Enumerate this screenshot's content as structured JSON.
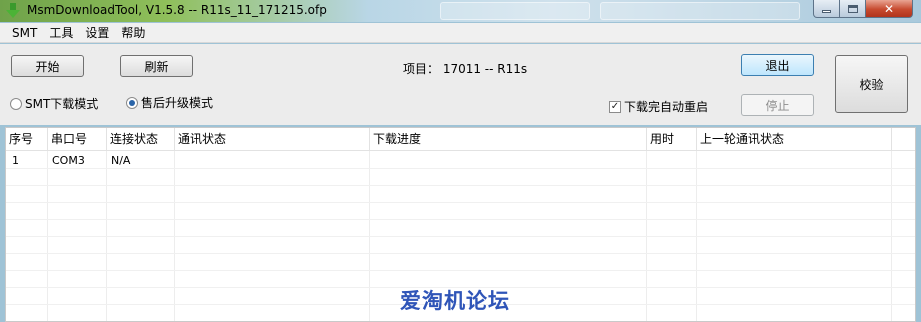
{
  "window": {
    "title": "MsmDownloadTool, V1.5.8 -- R11s_11_171215.ofp"
  },
  "menu": {
    "items": [
      "SMT",
      "工具",
      "设置",
      "帮助"
    ]
  },
  "toolbar": {
    "start_label": "开始",
    "refresh_label": "刷新",
    "project_text": "项目：  17011 -- R11s",
    "exit_label": "退出",
    "stop_label": "停止",
    "verify_label": "校验",
    "mode_smt_label": "SMT下载模式",
    "mode_aftersales_label": "售后升级模式",
    "selected_mode": "售后升级模式",
    "auto_restart_label": "下载完自动重启",
    "auto_restart_checked": true
  },
  "grid": {
    "columns": [
      "序号",
      "串口号",
      "连接状态",
      "通讯状态",
      "下载进度",
      "用时",
      "上一轮通讯状态"
    ],
    "rows": [
      {
        "index": "1",
        "port": "COM3",
        "connection": "N/A",
        "comm": "",
        "progress": "",
        "time": "",
        "last_comm": ""
      }
    ]
  },
  "watermark": "爱淘机论坛",
  "colors": {
    "accent": "#3c7fb1",
    "watermark": "#2f55b8",
    "close_button": "#c74a2f"
  }
}
